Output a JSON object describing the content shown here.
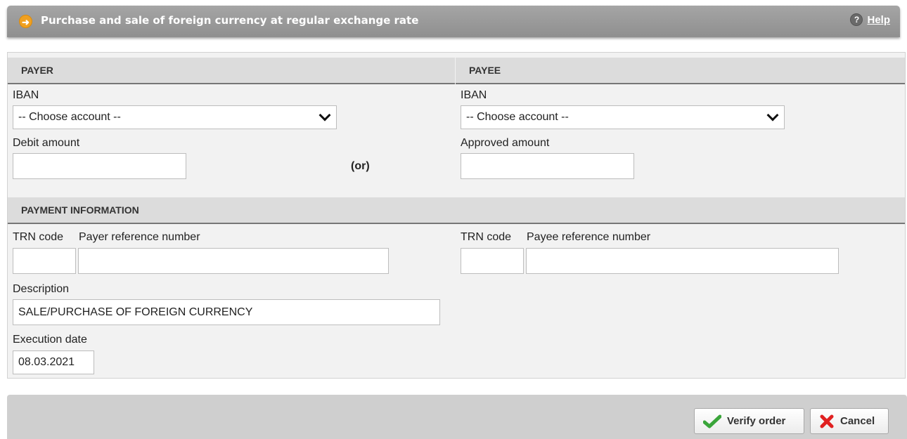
{
  "header": {
    "title": "Purchase and sale of foreign currency at regular exchange rate",
    "help_label": "Help"
  },
  "payer": {
    "section_title": "PAYER",
    "iban_label": "IBAN",
    "account_select": "-- Choose account --",
    "amount_label": "Debit amount",
    "amount_value": ""
  },
  "or_label": "(or)",
  "payee": {
    "section_title": "PAYEE",
    "iban_label": "IBAN",
    "account_select": "-- Choose account --",
    "amount_label": "Approved amount",
    "amount_value": ""
  },
  "payment_info": {
    "section_title": "PAYMENT INFORMATION",
    "payer_trn_label": "TRN code",
    "payer_ref_label": "Payer reference number",
    "payee_trn_label": "TRN code",
    "payee_ref_label": "Payee reference number",
    "description_label": "Description",
    "description_value": "SALE/PURCHASE OF FOREIGN CURRENCY",
    "execution_date_label": "Execution date",
    "execution_date_value": "08.03.2021"
  },
  "actions": {
    "verify_label": "Verify order",
    "cancel_label": "Cancel"
  },
  "colors": {
    "accent": "#f0a020",
    "verify_icon": "#3aa53a",
    "cancel_icon": "#e02020"
  }
}
